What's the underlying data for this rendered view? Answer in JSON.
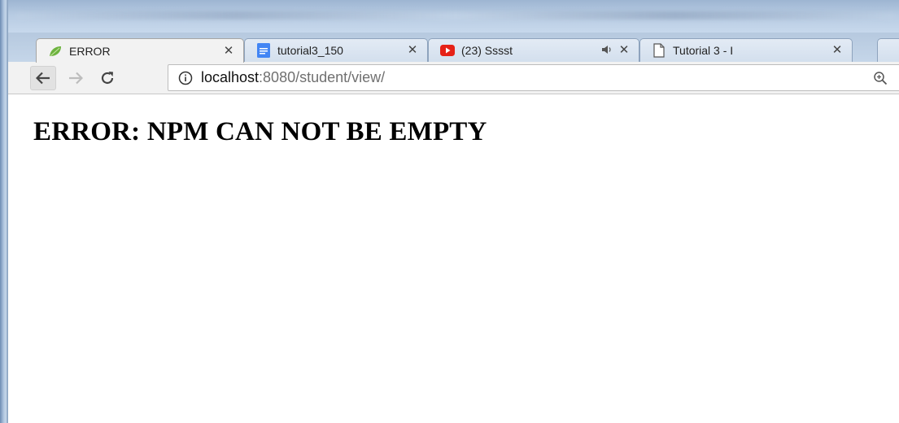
{
  "browser": {
    "tabs": [
      {
        "title": "ERROR",
        "favicon": "spring-leaf-icon",
        "active": true
      },
      {
        "title": "tutorial3_150",
        "favicon": "google-docs-icon",
        "active": false
      },
      {
        "title": "(23) Sssst",
        "favicon": "youtube-icon",
        "active": false,
        "audio": true
      },
      {
        "title": "Tutorial 3 - I",
        "favicon": "document-page-icon",
        "active": false
      }
    ],
    "close_glyph": "✕",
    "audio_glyph": "◀))",
    "address": {
      "host": "localhost",
      "path": ":8080/student/view/"
    },
    "colors": {
      "spring_green": "#6db33f",
      "docs_blue": "#4285f4",
      "youtube_red": "#e62117"
    }
  },
  "page": {
    "heading": "ERROR: NPM CAN NOT BE EMPTY"
  }
}
